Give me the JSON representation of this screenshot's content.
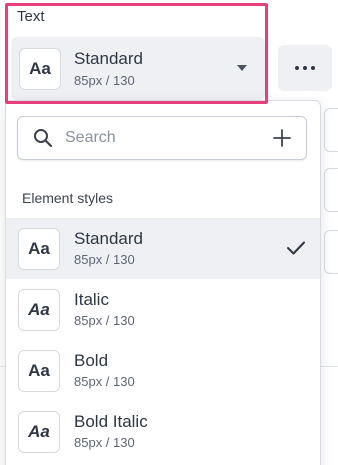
{
  "section": {
    "label": "Text"
  },
  "selector": {
    "icon_text": "Aa",
    "name": "Standard",
    "meta": "85px / 130"
  },
  "more_button": {
    "icon": "more-horizontal-icon"
  },
  "search": {
    "placeholder": "Search",
    "value": ""
  },
  "group": {
    "label": "Element styles"
  },
  "styles": [
    {
      "icon_text": "Aa",
      "name": "Standard",
      "meta": "85px / 130",
      "selected": true
    },
    {
      "icon_text": "Aa",
      "name": "Italic",
      "meta": "85px / 130",
      "selected": false
    },
    {
      "icon_text": "Aa",
      "name": "Bold",
      "meta": "85px / 130",
      "selected": false
    },
    {
      "icon_text": "Aa",
      "name": "Bold Italic",
      "meta": "85px / 130",
      "selected": false
    }
  ],
  "colors": {
    "highlight": "#e83e7c",
    "selected_bg": "#eef0f3"
  }
}
